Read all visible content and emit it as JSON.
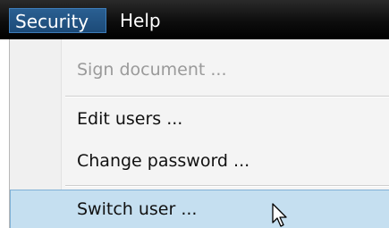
{
  "menubar": {
    "items": [
      {
        "label": "Security"
      },
      {
        "label": "Help"
      }
    ]
  },
  "security_menu": {
    "items": [
      {
        "label": "Sign document ...",
        "state": "disabled"
      },
      {
        "label": "Edit users ...",
        "state": "normal"
      },
      {
        "label": "Change password ...",
        "state": "normal"
      },
      {
        "label": "Switch user ...",
        "state": "highlighted"
      }
    ]
  },
  "colors": {
    "menubar_bg": "#000000",
    "menubar_active": "#1c4a78",
    "highlight_bg": "#c5dff0",
    "disabled_text": "#9a9a9a"
  },
  "icons": {
    "cursor": "mouse-pointer-icon"
  }
}
